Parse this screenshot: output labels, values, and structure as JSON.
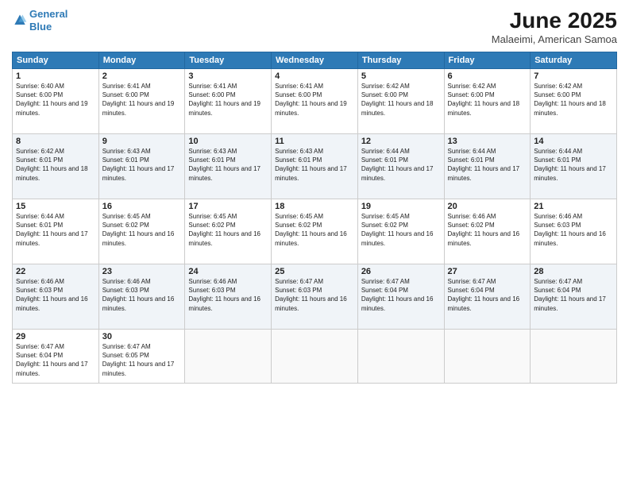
{
  "header": {
    "logo_line1": "General",
    "logo_line2": "Blue",
    "month": "June 2025",
    "location": "Malaeimi, American Samoa"
  },
  "weekdays": [
    "Sunday",
    "Monday",
    "Tuesday",
    "Wednesday",
    "Thursday",
    "Friday",
    "Saturday"
  ],
  "weeks": [
    [
      {
        "day": 1,
        "sunrise": "6:40 AM",
        "sunset": "6:00 PM",
        "daylight": "11 hours and 19 minutes."
      },
      {
        "day": 2,
        "sunrise": "6:41 AM",
        "sunset": "6:00 PM",
        "daylight": "11 hours and 19 minutes."
      },
      {
        "day": 3,
        "sunrise": "6:41 AM",
        "sunset": "6:00 PM",
        "daylight": "11 hours and 19 minutes."
      },
      {
        "day": 4,
        "sunrise": "6:41 AM",
        "sunset": "6:00 PM",
        "daylight": "11 hours and 19 minutes."
      },
      {
        "day": 5,
        "sunrise": "6:42 AM",
        "sunset": "6:00 PM",
        "daylight": "11 hours and 18 minutes."
      },
      {
        "day": 6,
        "sunrise": "6:42 AM",
        "sunset": "6:00 PM",
        "daylight": "11 hours and 18 minutes."
      },
      {
        "day": 7,
        "sunrise": "6:42 AM",
        "sunset": "6:00 PM",
        "daylight": "11 hours and 18 minutes."
      }
    ],
    [
      {
        "day": 8,
        "sunrise": "6:42 AM",
        "sunset": "6:01 PM",
        "daylight": "11 hours and 18 minutes."
      },
      {
        "day": 9,
        "sunrise": "6:43 AM",
        "sunset": "6:01 PM",
        "daylight": "11 hours and 17 minutes."
      },
      {
        "day": 10,
        "sunrise": "6:43 AM",
        "sunset": "6:01 PM",
        "daylight": "11 hours and 17 minutes."
      },
      {
        "day": 11,
        "sunrise": "6:43 AM",
        "sunset": "6:01 PM",
        "daylight": "11 hours and 17 minutes."
      },
      {
        "day": 12,
        "sunrise": "6:44 AM",
        "sunset": "6:01 PM",
        "daylight": "11 hours and 17 minutes."
      },
      {
        "day": 13,
        "sunrise": "6:44 AM",
        "sunset": "6:01 PM",
        "daylight": "11 hours and 17 minutes."
      },
      {
        "day": 14,
        "sunrise": "6:44 AM",
        "sunset": "6:01 PM",
        "daylight": "11 hours and 17 minutes."
      }
    ],
    [
      {
        "day": 15,
        "sunrise": "6:44 AM",
        "sunset": "6:01 PM",
        "daylight": "11 hours and 17 minutes."
      },
      {
        "day": 16,
        "sunrise": "6:45 AM",
        "sunset": "6:02 PM",
        "daylight": "11 hours and 16 minutes."
      },
      {
        "day": 17,
        "sunrise": "6:45 AM",
        "sunset": "6:02 PM",
        "daylight": "11 hours and 16 minutes."
      },
      {
        "day": 18,
        "sunrise": "6:45 AM",
        "sunset": "6:02 PM",
        "daylight": "11 hours and 16 minutes."
      },
      {
        "day": 19,
        "sunrise": "6:45 AM",
        "sunset": "6:02 PM",
        "daylight": "11 hours and 16 minutes."
      },
      {
        "day": 20,
        "sunrise": "6:46 AM",
        "sunset": "6:02 PM",
        "daylight": "11 hours and 16 minutes."
      },
      {
        "day": 21,
        "sunrise": "6:46 AM",
        "sunset": "6:03 PM",
        "daylight": "11 hours and 16 minutes."
      }
    ],
    [
      {
        "day": 22,
        "sunrise": "6:46 AM",
        "sunset": "6:03 PM",
        "daylight": "11 hours and 16 minutes."
      },
      {
        "day": 23,
        "sunrise": "6:46 AM",
        "sunset": "6:03 PM",
        "daylight": "11 hours and 16 minutes."
      },
      {
        "day": 24,
        "sunrise": "6:46 AM",
        "sunset": "6:03 PM",
        "daylight": "11 hours and 16 minutes."
      },
      {
        "day": 25,
        "sunrise": "6:47 AM",
        "sunset": "6:03 PM",
        "daylight": "11 hours and 16 minutes."
      },
      {
        "day": 26,
        "sunrise": "6:47 AM",
        "sunset": "6:04 PM",
        "daylight": "11 hours and 16 minutes."
      },
      {
        "day": 27,
        "sunrise": "6:47 AM",
        "sunset": "6:04 PM",
        "daylight": "11 hours and 16 minutes."
      },
      {
        "day": 28,
        "sunrise": "6:47 AM",
        "sunset": "6:04 PM",
        "daylight": "11 hours and 17 minutes."
      }
    ],
    [
      {
        "day": 29,
        "sunrise": "6:47 AM",
        "sunset": "6:04 PM",
        "daylight": "11 hours and 17 minutes."
      },
      {
        "day": 30,
        "sunrise": "6:47 AM",
        "sunset": "6:05 PM",
        "daylight": "11 hours and 17 minutes."
      },
      null,
      null,
      null,
      null,
      null
    ]
  ]
}
